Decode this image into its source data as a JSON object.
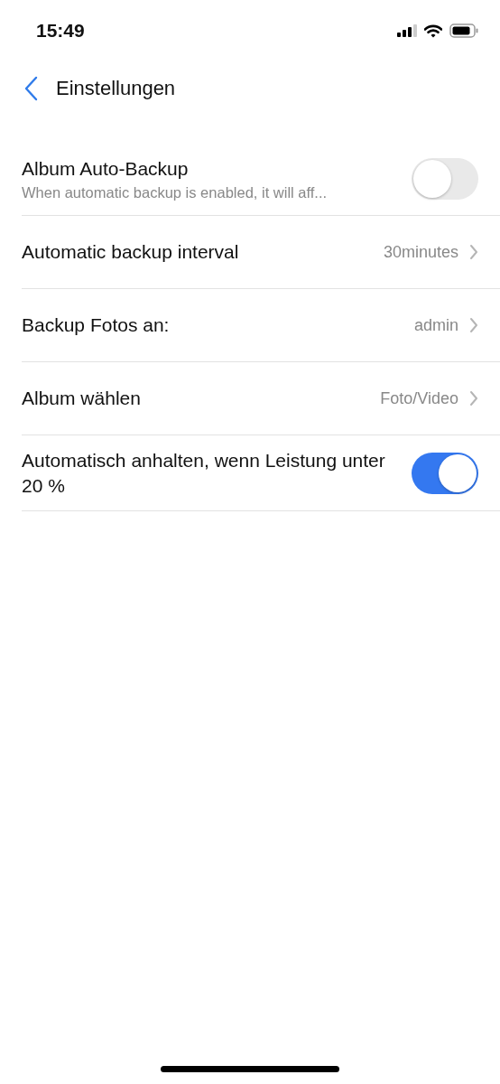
{
  "status_bar": {
    "time": "15:49"
  },
  "nav": {
    "title": "Einstellungen"
  },
  "rows": [
    {
      "kind": "toggle",
      "label": "Album Auto-Backup",
      "subtitle": "When automatic backup is enabled, it will aff...",
      "on": false
    },
    {
      "kind": "link",
      "label": "Automatic backup interval",
      "value": "30minutes"
    },
    {
      "kind": "link",
      "label": "Backup Fotos an:",
      "value": "admin"
    },
    {
      "kind": "link",
      "label": "Album wählen",
      "value": "Foto/Video"
    },
    {
      "kind": "toggle",
      "label": "Automatisch anhalten, wenn Leistung unter 20 %",
      "on": true
    }
  ]
}
